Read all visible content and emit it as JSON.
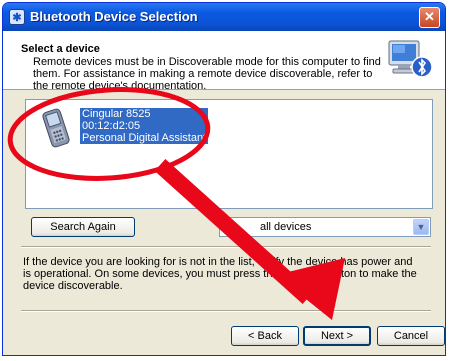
{
  "window": {
    "title": "Bluetooth Device Selection",
    "close_symbol": "✕"
  },
  "header": {
    "title": "Select a device",
    "description": "Remote devices must be in Discoverable mode for this computer to find them. For assistance in making a remote device discoverable, refer to the remote device's documentation.",
    "icon": "bluetooth-computer-icon"
  },
  "device_list": {
    "items": [
      {
        "name": "Cingular 8525",
        "address": "00:12:d2:05",
        "type": "Personal Digital Assistant",
        "icon": "pda-device-icon"
      }
    ]
  },
  "search_again_label": "Search Again",
  "filter": {
    "selected": "all devices"
  },
  "info_text": "If the device you are looking for is not in the list, verify the device has power and is operational. On some devices, you must press the Connect button to make the device discoverable.",
  "buttons": {
    "back": "< Back",
    "next": "Next >",
    "cancel": "Cancel"
  },
  "annotation": {
    "color": "#e8081a"
  }
}
